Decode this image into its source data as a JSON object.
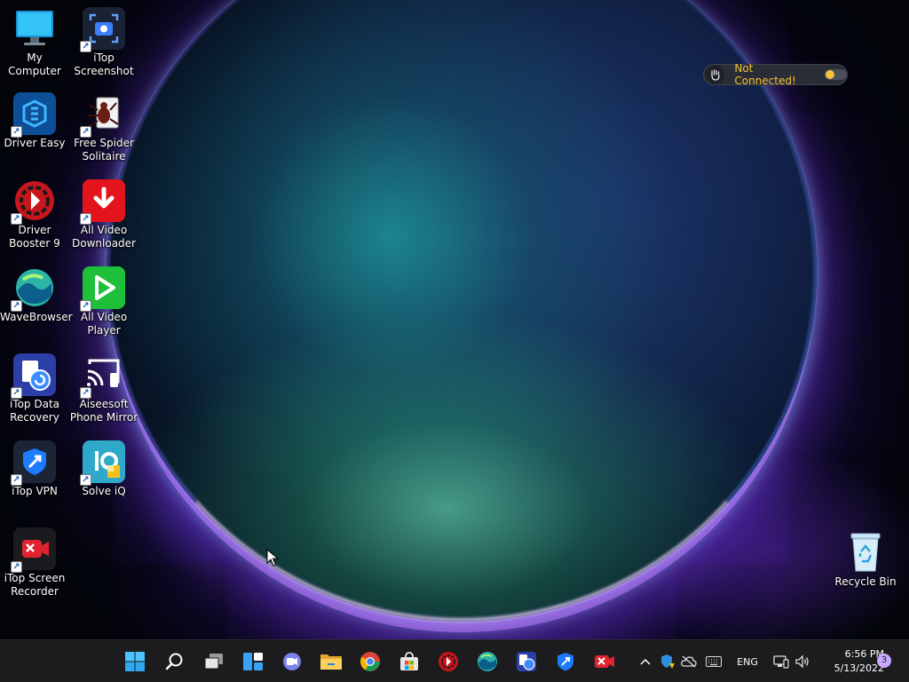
{
  "desktop": {
    "icons": [
      {
        "label": "My Computer"
      },
      {
        "label": "iTop Screenshot"
      },
      {
        "label": "Driver Easy"
      },
      {
        "label": "Free Spider Solitaire"
      },
      {
        "label": "Driver Booster 9"
      },
      {
        "label": "All Video Downloader"
      },
      {
        "label": "WaveBrowser"
      },
      {
        "label": "All Video Player"
      },
      {
        "label": "iTop Data Recovery"
      },
      {
        "label": "Aiseesoft Phone Mirror"
      },
      {
        "label": "iTop VPN"
      },
      {
        "label": "Solve iQ"
      },
      {
        "label": "iTop Screen Recorder"
      },
      {
        "label": "Recycle Bin"
      }
    ]
  },
  "vpn_widget": {
    "status": "Not Connected!",
    "status_color": "#f3c13a"
  },
  "taskbar": {
    "apps": [
      {
        "icon": "windows-start-icon"
      },
      {
        "icon": "search-icon"
      },
      {
        "icon": "task-view-icon"
      },
      {
        "icon": "widgets-icon"
      },
      {
        "icon": "teams-chat-icon"
      },
      {
        "icon": "file-explorer-icon"
      },
      {
        "icon": "chrome-icon"
      },
      {
        "icon": "microsoft-store-icon"
      },
      {
        "icon": "driver-booster-icon"
      },
      {
        "icon": "wavebrowser-icon"
      },
      {
        "icon": "itop-data-recovery-icon"
      },
      {
        "icon": "itop-vpn-icon"
      },
      {
        "icon": "itop-screen-recorder-icon"
      }
    ],
    "tray": {
      "language": "ENG",
      "time": "6:56 PM",
      "date": "5/13/2022",
      "notification_count": "3"
    }
  },
  "colors": {
    "taskbar_bg": "#1c1c1f",
    "accent": "#4cc2ff"
  }
}
